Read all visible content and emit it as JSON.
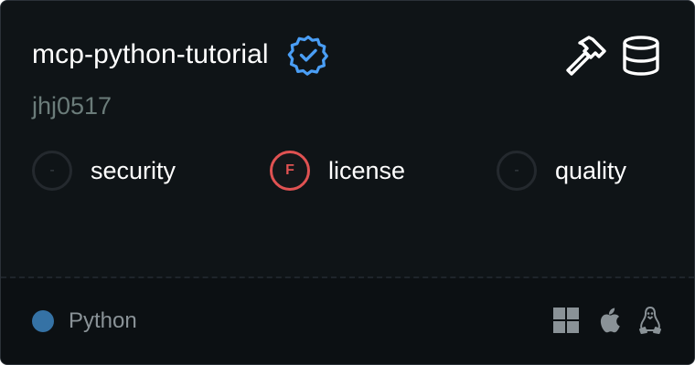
{
  "repo": {
    "title": "mcp-python-tutorial",
    "owner": "jhj0517",
    "verified_icon": "verified-badge-icon",
    "verified_color": "#4a9ef5"
  },
  "header_icons": [
    {
      "name": "hammer-icon"
    },
    {
      "name": "database-icon"
    }
  ],
  "metrics": [
    {
      "label": "security",
      "grade": "-",
      "status": "none"
    },
    {
      "label": "license",
      "grade": "F",
      "status": "fail",
      "color": "#e05252"
    },
    {
      "label": "quality",
      "grade": "-",
      "status": "none"
    }
  ],
  "footer": {
    "language": "Python",
    "language_color": "#3572a5",
    "platforms": [
      "windows-icon",
      "apple-icon",
      "linux-icon"
    ]
  }
}
